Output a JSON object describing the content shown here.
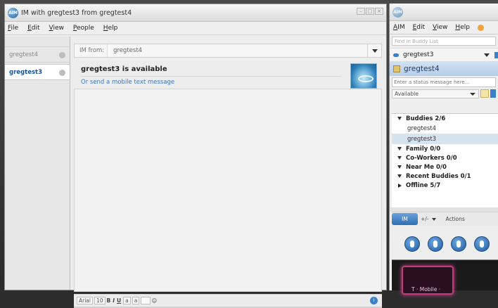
{
  "im_window": {
    "title": "IM with gregtest3 from gregtest4",
    "menu": [
      "File",
      "Edit",
      "View",
      "People",
      "Help"
    ],
    "tabs": [
      {
        "label": "gregtest4",
        "active": false
      },
      {
        "label": "gregtest3",
        "active": true
      }
    ],
    "from_label": "IM from:",
    "from_value": "gregtest4",
    "status_text": "gregtest3 is available",
    "mobile_link": "Or send a mobile text message",
    "format_bar": {
      "font": "Arial",
      "size": "10",
      "bold": "B",
      "italic": "I",
      "underline": "U",
      "text_color": "a",
      "bg_color": "a",
      "help": "i"
    },
    "logo_text": "AIM",
    "window_controls": [
      "–",
      "□",
      "×"
    ]
  },
  "buddy_window": {
    "menu": [
      "AIM",
      "Edit",
      "View",
      "Help"
    ],
    "search_placeholder": "Find in Buddy List",
    "screen_name": "gregtest3",
    "my_name": "gregtest4",
    "status_placeholder": "Enter a status message here...",
    "availability": "Available",
    "groups": [
      {
        "label": "Buddies 2/6",
        "expanded": true,
        "buddies": [
          {
            "name": "gregtest4",
            "selected": false
          },
          {
            "name": "gregtest3",
            "selected": true
          }
        ]
      },
      {
        "label": "Family 0/0",
        "expanded": true,
        "buddies": []
      },
      {
        "label": "Co-Workers 0/0",
        "expanded": true,
        "buddies": []
      },
      {
        "label": "Near Me 0/0",
        "expanded": true,
        "buddies": []
      },
      {
        "label": "Recent Buddies 0/1",
        "expanded": true,
        "buddies": []
      },
      {
        "label": "Offline 5/7",
        "expanded": false,
        "buddies": []
      }
    ],
    "actions": {
      "im": "IM",
      "add_remove": "+/-",
      "actions": "Actions"
    },
    "ad_text": "T · Mobile ·"
  },
  "colors": {
    "accent": "#3b7fc8",
    "link": "#3f78bd",
    "selected_row": "#d7e3ef",
    "ad_magenta": "#c33a7f"
  }
}
